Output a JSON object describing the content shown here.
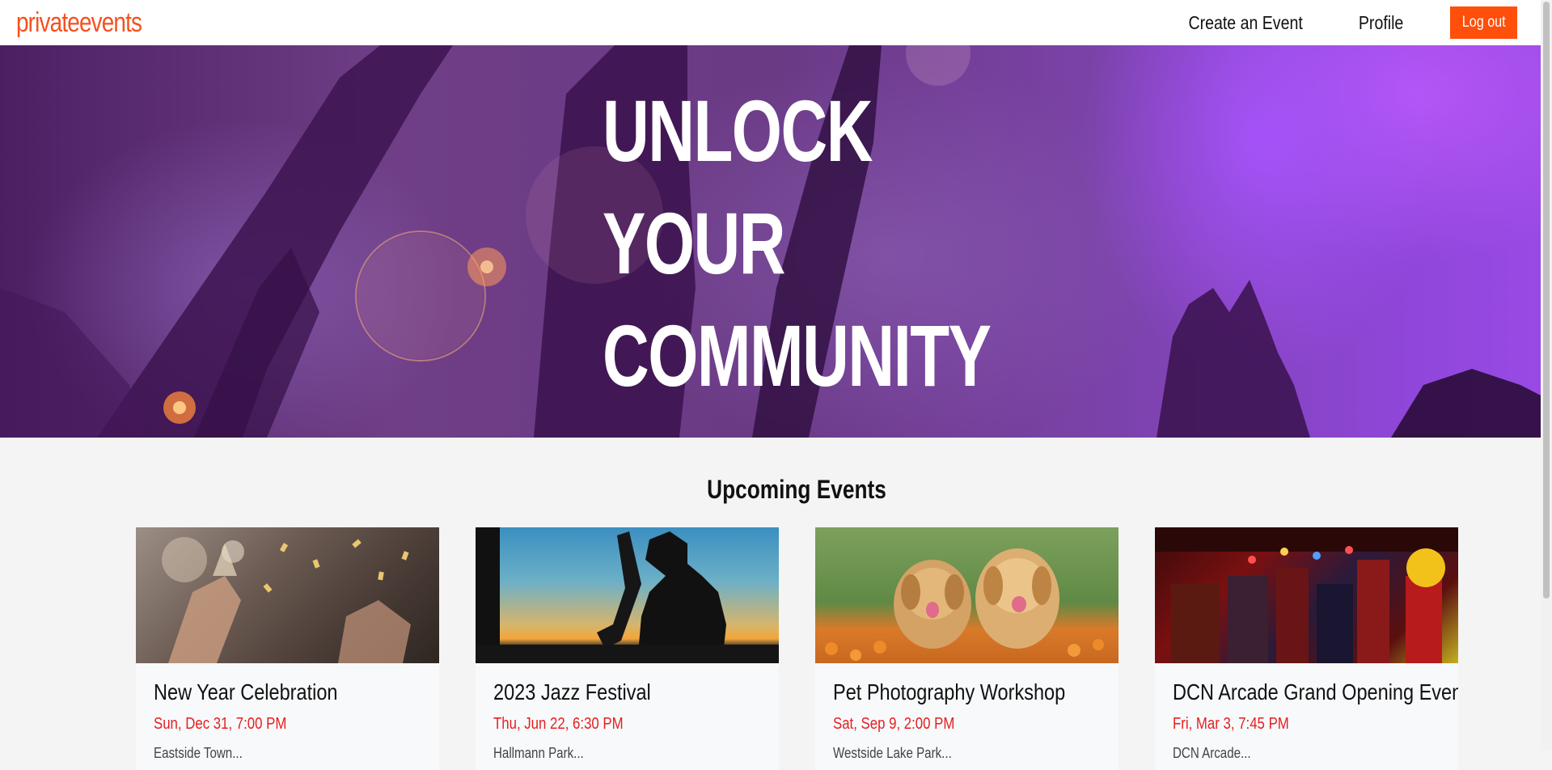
{
  "navbar": {
    "brand": "privateevents",
    "links": [
      {
        "label": "Create an Event"
      },
      {
        "label": "Profile"
      }
    ],
    "logout_label": "Log out"
  },
  "hero": {
    "lines": [
      "UNLOCK",
      "YOUR",
      "COMMUNITY"
    ]
  },
  "events": {
    "heading": "Upcoming Events",
    "items": [
      {
        "title": "New Year Celebration",
        "date": "Sun, Dec 31, 7:00 PM",
        "location": "Eastside Town...",
        "image": "party-champagne-image"
      },
      {
        "title": "2023 Jazz Festival",
        "date": "Thu, Jun 22, 6:30 PM",
        "location": "Hallmann Park...",
        "image": "saxophone-sunset-image"
      },
      {
        "title": "Pet Photography Workshop",
        "date": "Sat, Sep 9, 2:00 PM",
        "location": "Westside Lake Park...",
        "image": "puppies-flowers-image"
      },
      {
        "title": "DCN Arcade Grand Opening Event",
        "date": "Fri, Mar 3, 7:45 PM",
        "location": "DCN Arcade...",
        "image": "arcade-interior-image"
      }
    ]
  },
  "colors": {
    "brand": "#f4511e",
    "logout_button": "#ff4f0a",
    "date_text": "#e61e1e"
  }
}
